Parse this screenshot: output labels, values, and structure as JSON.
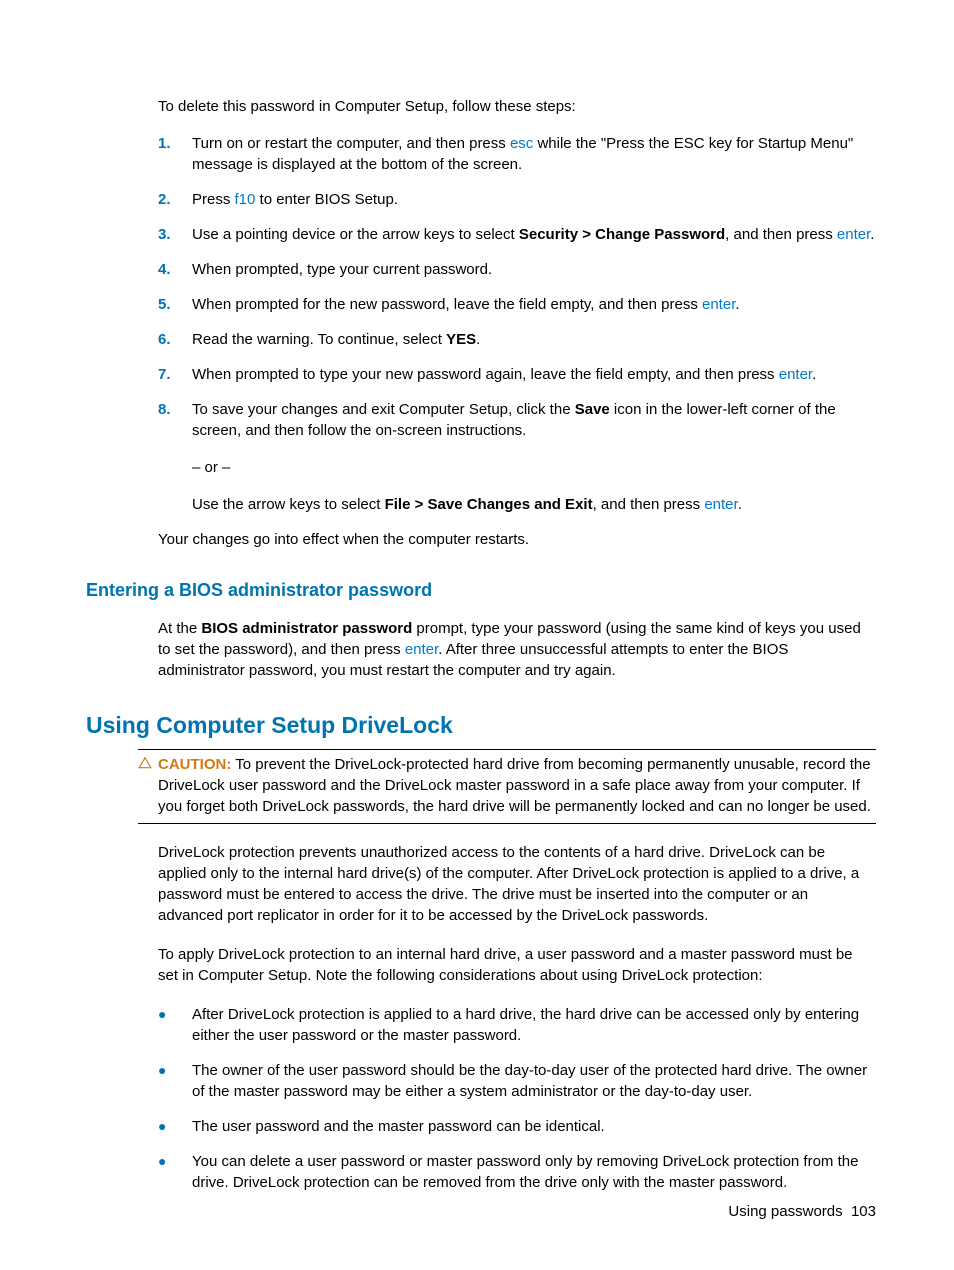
{
  "intro": "To delete this password in Computer Setup, follow these steps:",
  "steps": [
    {
      "n": "1.",
      "pre": "Turn on or restart the computer, and then press ",
      "kw": "esc",
      "post": " while the \"Press the ESC key for Startup Menu\" message is displayed at the bottom of the screen."
    },
    {
      "n": "2.",
      "pre": "Press ",
      "kw": "f10",
      "post": " to enter BIOS Setup."
    },
    {
      "n": "3.",
      "pre": "Use a pointing device or the arrow keys to select ",
      "bold": "Security > Change Password",
      "mid": ", and then press ",
      "kw": "enter",
      "post": "."
    },
    {
      "n": "4.",
      "plain": "When prompted, type your current password."
    },
    {
      "n": "5.",
      "pre": "When prompted for the new password, leave the field empty, and then press ",
      "kw": "enter",
      "post": "."
    },
    {
      "n": "6.",
      "pre": "Read the warning. To continue, select ",
      "bold": "YES",
      "post": "."
    },
    {
      "n": "7.",
      "pre": "When prompted to type your new password again, leave the field empty, and then press ",
      "kw": "enter",
      "post": "."
    }
  ],
  "step8": {
    "n": "8.",
    "line1a": "To save your changes and exit Computer Setup, click the ",
    "line1b": "Save",
    "line1c": " icon in the lower-left corner of the screen, and then follow the on-screen instructions.",
    "or": "– or –",
    "line2a": "Use the arrow keys to select ",
    "line2b": "File > Save Changes and Exit",
    "line2c": ", and then press ",
    "line2kw": "enter",
    "line2d": "."
  },
  "afterSteps": "Your changes go into effect when the computer restarts.",
  "subHeading": "Entering a BIOS administrator password",
  "subBody": {
    "a": "At the ",
    "b": "BIOS administrator password",
    "c": " prompt, type your password (using the same kind of keys you used to set the password), and then press ",
    "kw": "enter",
    "d": ". After three unsuccessful attempts to enter the BIOS administrator password, you must restart the computer and try again."
  },
  "sectionHeading": "Using Computer Setup DriveLock",
  "caution": {
    "label": "CAUTION:",
    "text": "   To prevent the DriveLock-protected hard drive from becoming permanently unusable, record the DriveLock user password and the DriveLock master password in a safe place away from your computer. If you forget both DriveLock passwords, the hard drive will be permanently locked and can no longer be used."
  },
  "dlPara1": "DriveLock protection prevents unauthorized access to the contents of a hard drive. DriveLock can be applied only to the internal hard drive(s) of the computer. After DriveLock protection is applied to a drive, a password must be entered to access the drive. The drive must be inserted into the computer or an advanced port replicator in order for it to be accessed by the DriveLock passwords.",
  "dlPara2": "To apply DriveLock protection to an internal hard drive, a user password and a master password must be set in Computer Setup. Note the following considerations about using DriveLock protection:",
  "bullets": [
    "After DriveLock protection is applied to a hard drive, the hard drive can be accessed only by entering either the user password or the master password.",
    "The owner of the user password should be the day-to-day user of the protected hard drive. The owner of the master password may be either a system administrator or the day-to-day user.",
    "The user password and the master password can be identical.",
    "You can delete a user password or master password only by removing DriveLock protection from the drive. DriveLock protection can be removed from the drive only with the master password."
  ],
  "footer": {
    "label": "Using passwords",
    "page": "103"
  }
}
